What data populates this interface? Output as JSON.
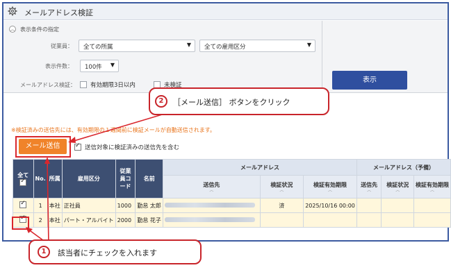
{
  "window": {
    "title": "メールアドレス検証"
  },
  "filter": {
    "section_label": "表示条件の指定",
    "employee_label": "従業員：",
    "department_select": "全ての所属",
    "employment_select": "全ての雇用区分",
    "rows_label": "表示件数：",
    "rows_select": "100件",
    "mail_verify_label": "メールアドレス検証：",
    "option_valid3days": "有効期限3日以内",
    "option_unverified": "未検証",
    "show_button": "表示"
  },
  "notice": "※検証済みの送信先には、有効期限の１週間前に検証メールが自動送信されます。",
  "toolbar": {
    "mail_send_button": "メール送信",
    "include_verified_label": "送信対象に検証済みの送信先を含む"
  },
  "table": {
    "headers": {
      "all": "全て",
      "no": "No.",
      "dept": "所属",
      "employment": "雇用区分",
      "emp_code": "従業員コード",
      "name": "名前",
      "email_group": "メールアドレス",
      "email_spare_group": "メールアドレス（予備）",
      "send_to": "送信先",
      "status": "検証状況",
      "expiry": "検証有効期限",
      "send_to2": "送信先",
      "status2": "検証状況",
      "expiry2": "検証有効期限"
    },
    "rows": [
      {
        "checked": true,
        "no": "1",
        "dept": "本社",
        "employment": "正社員",
        "code": "1000",
        "name": "勤怠 太郎",
        "status": "済",
        "expiry": "2025/10/16 00:00"
      },
      {
        "checked": true,
        "no": "2",
        "dept": "本社",
        "employment": "パート・アルバイト",
        "code": "2000",
        "name": "勤怠 花子",
        "status": "",
        "expiry": ""
      }
    ]
  },
  "callouts": {
    "step1_number": "1",
    "step1_text": "該当者にチェックを入れます",
    "step2_number": "2",
    "step2_text": "［メール送信］ ボタンをクリック"
  },
  "colors": {
    "accent_blue": "#2f4f9f",
    "mail_button": "#f0832a",
    "highlight_red": "#d9262c",
    "notice_orange": "#e8731a",
    "row_bg": "#fff7dc"
  },
  "icons": {
    "title": "gear-icon",
    "fold": "chevron-up-icon"
  }
}
